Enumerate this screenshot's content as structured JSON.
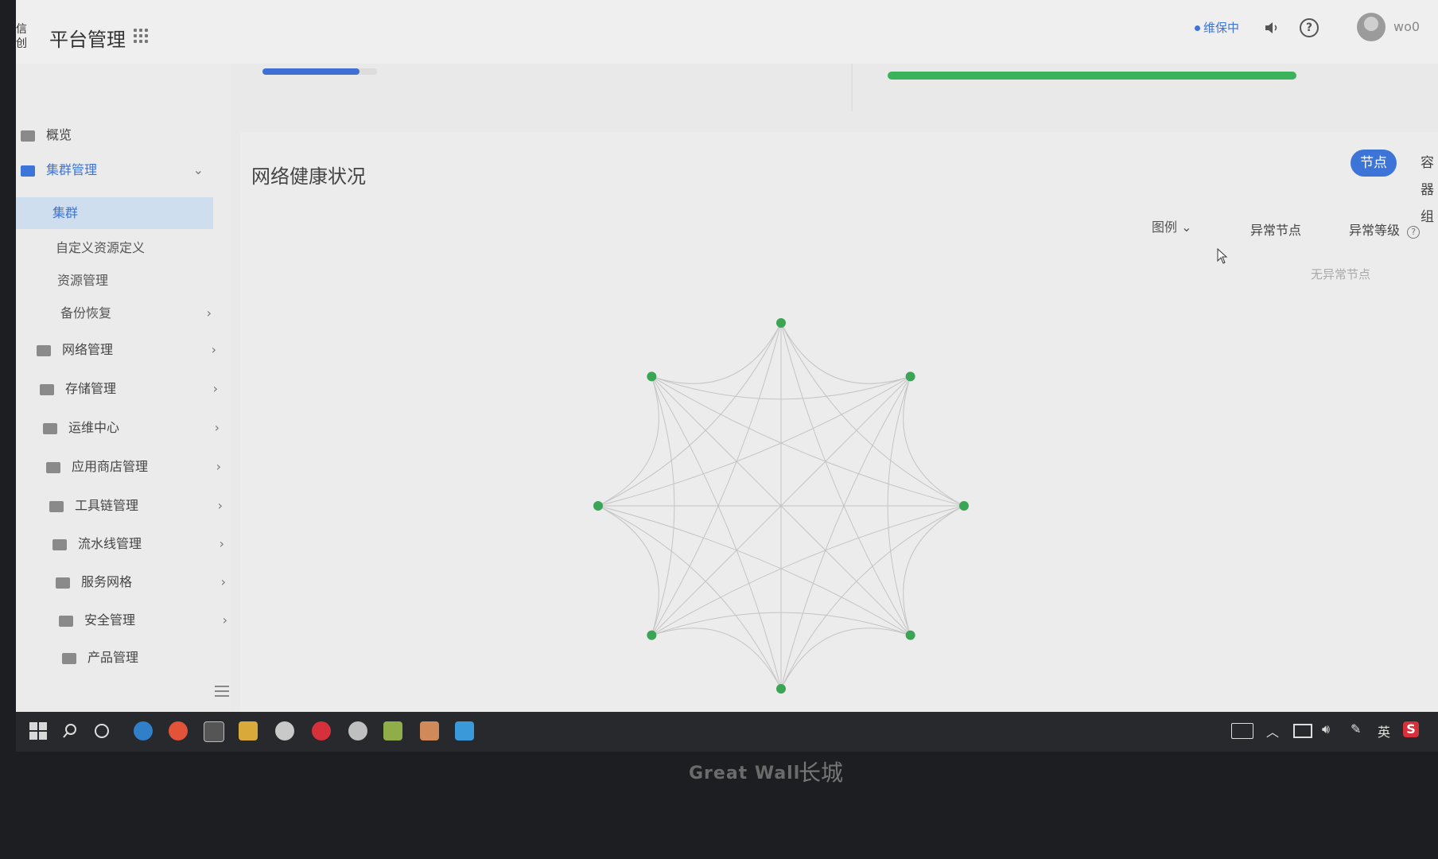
{
  "header": {
    "logo_text": "信创",
    "app_title": "平台管理",
    "status_badge": "维保中",
    "username": "wo0",
    "icons": [
      "grid-icon",
      "speaker-icon",
      "help-icon",
      "avatar"
    ]
  },
  "top_cards": {
    "mini_progress_fraction": 0.85,
    "usage_progress_fraction": 1.0
  },
  "sidebar": {
    "items": [
      {
        "label": "概览",
        "icon": "chart-icon",
        "chevron": ""
      },
      {
        "label": "集群管理",
        "icon": "cluster-icon",
        "chevron": "down"
      },
      {
        "label": "网络管理",
        "icon": "globe-icon",
        "chevron": "right"
      },
      {
        "label": "存储管理",
        "icon": "database-icon",
        "chevron": "right"
      },
      {
        "label": "运维中心",
        "icon": "ops-icon",
        "chevron": "right"
      },
      {
        "label": "应用商店管理",
        "icon": "store-icon",
        "chevron": "right"
      },
      {
        "label": "工具链管理",
        "icon": "tools-icon",
        "chevron": "right"
      },
      {
        "label": "流水线管理",
        "icon": "pipeline-icon",
        "chevron": "right"
      },
      {
        "label": "服务网格",
        "icon": "mesh-icon",
        "chevron": "right"
      },
      {
        "label": "安全管理",
        "icon": "shield-icon",
        "chevron": "right"
      },
      {
        "label": "产品管理",
        "icon": "box-icon",
        "chevron": ""
      }
    ],
    "sub_items": [
      {
        "label": "集群",
        "selected": true
      },
      {
        "label": "自定义资源定义",
        "selected": false
      },
      {
        "label": "资源管理",
        "selected": false
      },
      {
        "label": "备份恢复",
        "selected": false,
        "chevron": "right"
      }
    ]
  },
  "panel": {
    "title": "网络健康状况",
    "toggle_on": "节点",
    "toggle_off": "容器组",
    "legend_label": "图例",
    "col_abnormal_nodes": "异常节点",
    "col_abnormal_level": "异常等级",
    "empty_note": "无异常节点"
  },
  "graph": {
    "node_count": 8,
    "node_color": "#3aa655",
    "edge_color": "#c4c4c4"
  },
  "bezel": {
    "brand": "Great Wall",
    "mark": "长城"
  },
  "taskbar": {
    "tray_ime": "英",
    "tray_s": "S"
  }
}
